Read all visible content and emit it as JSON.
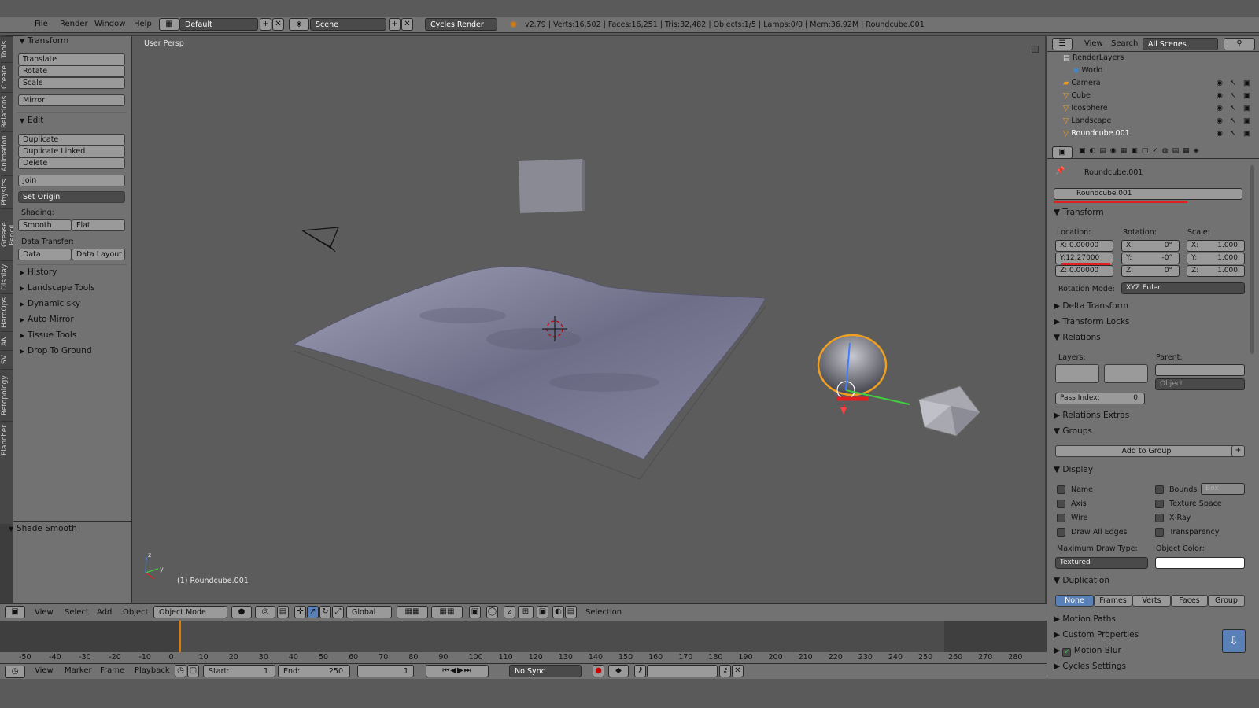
{
  "topbar": {
    "menus": [
      "File",
      "Render",
      "Window",
      "Help"
    ],
    "layout": "Default",
    "scene": "Scene",
    "engine": "Cycles Render",
    "stats": "v2.79 | Verts:16,502 | Faces:16,251 | Tris:32,482 | Objects:1/5 | Lamps:0/0 | Mem:36.92M | Roundcube.001"
  },
  "tabs": [
    "Tools",
    "Create",
    "Relations",
    "Animation",
    "Physics",
    "Grease Pencil",
    "Display",
    "HardOps",
    "AN",
    "SV",
    "Retopology",
    "Plancher"
  ],
  "toolshelf": {
    "transform_title": "Transform",
    "translate": "Translate",
    "rotate": "Rotate",
    "scale": "Scale",
    "mirror": "Mirror",
    "edit_title": "Edit",
    "duplicate": "Duplicate",
    "duplicate_linked": "Duplicate Linked",
    "delete": "Delete",
    "join": "Join",
    "set_origin": "Set Origin",
    "shading_label": "Shading:",
    "smooth": "Smooth",
    "flat": "Flat",
    "data_transfer_label": "Data Transfer:",
    "data": "Data",
    "data_layout": "Data Layout",
    "collapsed": [
      "History",
      "Landscape Tools",
      "Dynamic sky",
      "Auto Mirror",
      "Tissue Tools",
      "Drop To Ground"
    ],
    "operator_panel": "Shade Smooth"
  },
  "viewport": {
    "view_label": "User Persp",
    "object_label": "(1) Roundcube.001",
    "colors": {
      "bg": "#5c5c5c",
      "mesh": "#8a8aa0",
      "selected": "#f0a020"
    }
  },
  "vheader": {
    "menus": [
      "View",
      "Select",
      "Add",
      "Object"
    ],
    "mode": "Object Mode",
    "orientation": "Global",
    "selection": "Selection"
  },
  "timeline": {
    "ticks": [
      "-50",
      "-40",
      "-30",
      "-20",
      "-10",
      "0",
      "10",
      "20",
      "30",
      "40",
      "50",
      "60",
      "70",
      "80",
      "90",
      "100",
      "110",
      "120",
      "130",
      "140",
      "150",
      "160",
      "170",
      "180",
      "190",
      "200",
      "210",
      "220",
      "230",
      "240",
      "250",
      "260",
      "270",
      "280"
    ],
    "menus": [
      "View",
      "Marker",
      "Frame",
      "Playback"
    ],
    "start_label": "Start:",
    "start": "1",
    "end_label": "End:",
    "end": "250",
    "current": "1",
    "sync": "No Sync"
  },
  "outliner": {
    "menus": [
      "View",
      "Search"
    ],
    "scenes": "All Scenes",
    "items": [
      "RenderLayers",
      "World",
      "Camera",
      "Cube",
      "Icosphere",
      "Landscape",
      "Roundcube.001"
    ]
  },
  "properties": {
    "breadcrumb": "Roundcube.001",
    "object_name": "Roundcube.001",
    "transform_title": "Transform",
    "location_label": "Location:",
    "rotation_label": "Rotation:",
    "scale_label": "Scale:",
    "loc": [
      "X:  0.00000",
      "Y:12.27000",
      "Z:  0.00000"
    ],
    "rot": [
      "X:",
      "Y:",
      "Z:"
    ],
    "rot_vals": [
      "0°",
      "-0°",
      "0°"
    ],
    "scl": [
      "X:",
      "Y:",
      "Z:"
    ],
    "scl_vals": [
      "1.000",
      "1.000",
      "1.000"
    ],
    "rotation_mode_label": "Rotation Mode:",
    "rotation_mode": "XYZ Euler",
    "delta": "Delta Transform",
    "locks": "Transform Locks",
    "relations": "Relations",
    "layers_label": "Layers:",
    "parent_label": "Parent:",
    "parent_type": "Object",
    "pass_index_label": "Pass Index:",
    "pass_index": "0",
    "relations_extras": "Relations Extras",
    "groups": "Groups",
    "add_to_group": "Add to Group",
    "display": "Display",
    "name": "Name",
    "axis": "Axis",
    "wire": "Wire",
    "draw_all_edges": "Draw All Edges",
    "bounds": "Bounds",
    "bounds_type": "Box",
    "texture_space": "Texture Space",
    "xray": "X-Ray",
    "transparency": "Transparency",
    "max_draw_type_label": "Maximum Draw Type:",
    "max_draw_type": "Textured",
    "object_color_label": "Object Color:",
    "duplication": "Duplication",
    "dup_options": [
      "None",
      "Frames",
      "Verts",
      "Faces",
      "Group"
    ],
    "motion_paths": "Motion Paths",
    "custom_properties": "Custom Properties",
    "motion_blur": "Motion Blur",
    "cycles_settings": "Cycles Settings"
  }
}
